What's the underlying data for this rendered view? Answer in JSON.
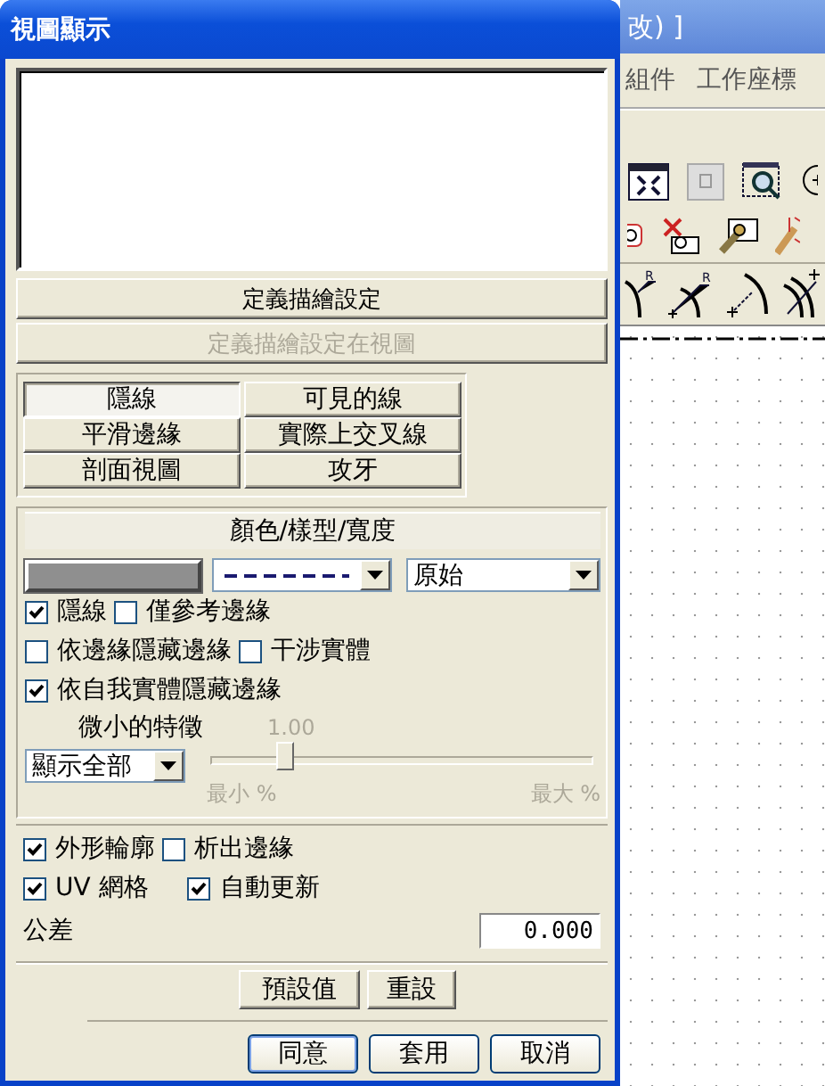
{
  "window": {
    "title": "視圖顯示"
  },
  "top_buttons": [
    {
      "label": "定義描繪設定",
      "disabled": false
    },
    {
      "label": "定義描繪設定在視圖",
      "disabled": true
    }
  ],
  "display_modes": [
    {
      "label": "隱線",
      "selected": true
    },
    {
      "label": "可見的線",
      "selected": false
    },
    {
      "label": "平滑邊緣",
      "selected": false
    },
    {
      "label": "實際上交叉線",
      "selected": false
    },
    {
      "label": "剖面視圖",
      "selected": false
    },
    {
      "label": "攻牙",
      "selected": false
    }
  ],
  "line_style": {
    "header": "顏色/樣型/寬度",
    "width": "原始"
  },
  "option_rows": [
    [
      {
        "label": "隱線",
        "checked": true
      },
      {
        "label": "僅參考邊緣",
        "checked": false
      }
    ],
    [
      {
        "label": "依邊緣隱藏邊緣",
        "checked": false
      },
      {
        "label": "干涉實體",
        "checked": false
      }
    ],
    [
      {
        "label": "依自我實體隱藏邊緣",
        "checked": true
      }
    ]
  ],
  "small_features": {
    "label": "微小的特徵",
    "value": "1.00",
    "show": "顯示全部",
    "level": 0.19,
    "min_label": "最小 %",
    "max_label": "最大 %"
  },
  "option_rows2": [
    [
      {
        "label": "外形輪廓",
        "checked": true
      },
      {
        "label": "析出邊緣",
        "checked": false
      }
    ],
    [
      {
        "label": "UV 網格",
        "checked": true
      },
      {
        "label": "自動更新",
        "checked": true
      }
    ]
  ],
  "tolerance": {
    "label": "公差",
    "value": "0.000"
  },
  "reset_buttons": [
    "預設值",
    "重設"
  ],
  "dialog_buttons": [
    "同意",
    "套用",
    "取消"
  ],
  "background_app": {
    "title": "改) ]",
    "menu": [
      "組件",
      "工作座標"
    ],
    "dimension_marks": [
      "R",
      "R"
    ]
  }
}
